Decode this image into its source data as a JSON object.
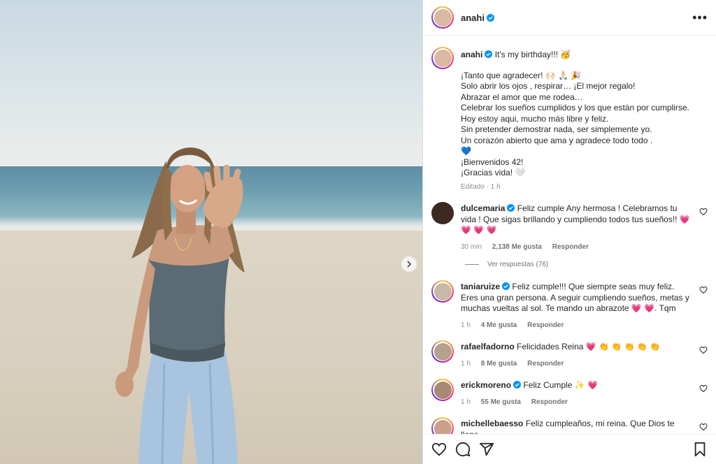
{
  "post": {
    "username": "anahi",
    "caption_first": "It's my birthday!!! 🥳",
    "caption_lines": [
      "¡Tanto que agradecer! 🙌🏻 🙏🏻 🎉",
      "Solo abrir los ojos , respirar… ¡El mejor regalo!",
      "Abrazar el amor que me rodea…",
      "Celebrar los sueños cumplidos y los que están por cumplirse.",
      "Hoy estoy aqui, mucho más libre y feliz.",
      "Sin pretender demostrar nada, ser simplemente yo.",
      "Un corazón abierto que ama y agradece todo todo .",
      "💙",
      "¡Bienvenidos 42!",
      "¡Gracias vida! 🤍"
    ],
    "edited_label": "Editado · 1 h"
  },
  "comments": [
    {
      "username": "dulcemaria",
      "verified": true,
      "text": "Feliz cumple Any hermosa ! Celebramos tu vida ! Que sigas brillando y cumpliendo todos tus sueños!! 💗 💗 💗 💗",
      "time": "30 min",
      "likes": "2,138 Me gusta",
      "reply": "Responder",
      "view_replies": "Ver respuestas (76)"
    },
    {
      "username": "taniaruize",
      "verified": true,
      "text": "Feliz cumple!!! Que siempre seas muy feliz. Eres una gran persona. A seguir cumpliendo sueños, metas y muchas vueltas al sol. Te mando un abrazote 💗 💗. Tqm",
      "time": "1 h",
      "likes": "4 Me gusta",
      "reply": "Responder"
    },
    {
      "username": "rafaelfadorno",
      "verified": false,
      "text": "Felicidades Reina 💗 👏 👏 👏 👏 👏",
      "time": "1 h",
      "likes": "8 Me gusta",
      "reply": "Responder"
    },
    {
      "username": "erickmoreno",
      "verified": true,
      "text": "Feliz Cumple ✨ 💗",
      "time": "1 h",
      "likes": "55 Me gusta",
      "reply": "Responder"
    },
    {
      "username": "michellebaesso",
      "verified": false,
      "text": "Feliz cumpleaños, mi reina. Que Dios te llene",
      "time": "",
      "likes": "",
      "reply": ""
    }
  ],
  "colors": {
    "verified": "#0095f6",
    "text": "#262626",
    "muted": "#8e8e8e"
  }
}
